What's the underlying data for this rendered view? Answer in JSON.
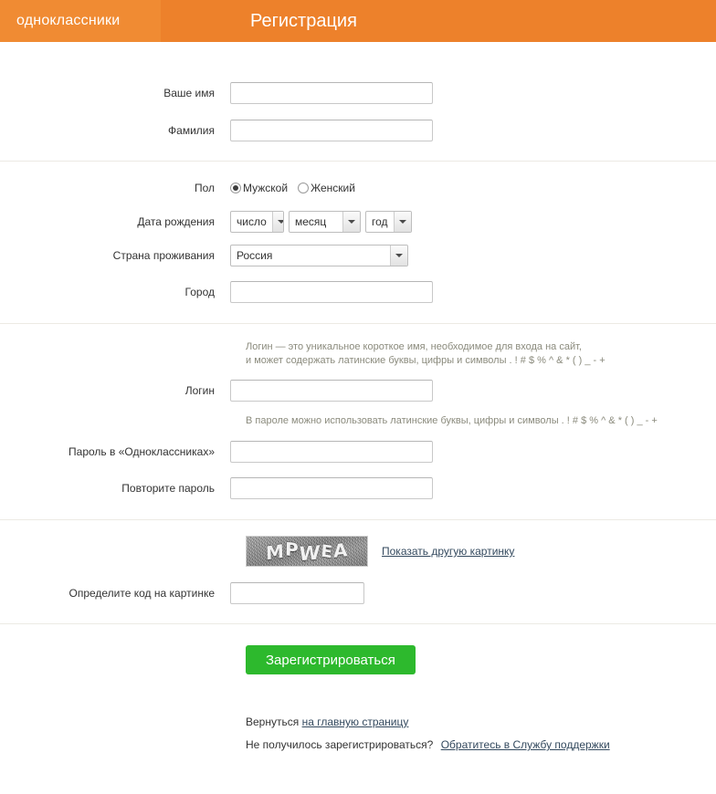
{
  "header": {
    "logo": "одноклассники",
    "title": "Регистрация",
    "bg_color": "#ed812b",
    "logo_bg_color": "#f08b33"
  },
  "form": {
    "first_name": {
      "label": "Ваше имя",
      "value": "",
      "placeholder": ""
    },
    "last_name": {
      "label": "Фамилия",
      "value": "",
      "placeholder": ""
    },
    "gender": {
      "label": "Пол",
      "options": [
        {
          "label": "Мужской",
          "selected": true
        },
        {
          "label": "Женский",
          "selected": false
        }
      ]
    },
    "birthdate": {
      "label": "Дата рождения",
      "day": "число",
      "month": "месяц",
      "year": "год"
    },
    "country": {
      "label": "Страна проживания",
      "value": "Россия"
    },
    "city": {
      "label": "Город",
      "value": "",
      "placeholder": ""
    },
    "login_hint_line1": "Логин — это уникальное короткое имя, необходимое для входа на сайт,",
    "login_hint_line2": "и может содержать латинские буквы, цифры и символы . ! # $ % ^ & * ( ) _ - +",
    "login": {
      "label": "Логин",
      "value": "",
      "placeholder": ""
    },
    "password_hint": "В пароле можно использовать латинские буквы, цифры и символы . ! # $ % ^ & * ( ) _ - +",
    "password": {
      "label": "Пароль в «Одноклассниках»",
      "value": "",
      "placeholder": ""
    },
    "password_repeat": {
      "label": "Повторите пароль",
      "value": "",
      "placeholder": ""
    },
    "captcha": {
      "label": "Определите код на картинке",
      "image_text": "MPWEA",
      "refresh_link": "Показать другую картинку",
      "value": "",
      "placeholder": ""
    },
    "submit": {
      "label": "Зарегистрироваться",
      "color": "#2db92d"
    }
  },
  "footer": {
    "back_prefix": "Вернуться",
    "back_link": "на главную страницу",
    "support_prefix": "Не получилось зарегистрироваться?",
    "support_link": "Обратитесь в Службу поддержки"
  }
}
